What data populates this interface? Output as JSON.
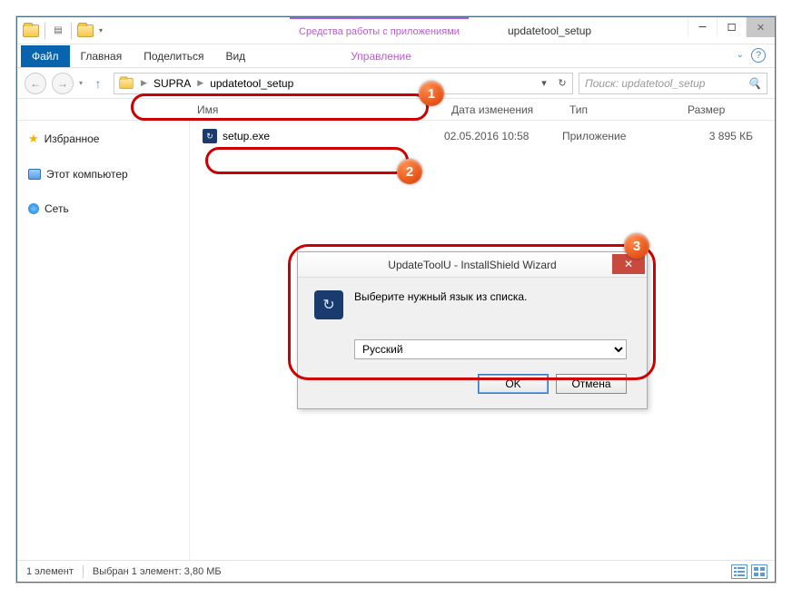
{
  "window": {
    "tools_context": "Средства работы с приложениями",
    "title": "updatetool_setup"
  },
  "ribbon": {
    "file": "Файл",
    "home": "Главная",
    "share": "Поделиться",
    "view": "Вид",
    "manage": "Управление"
  },
  "nav": {
    "crumb1": "SUPRA",
    "crumb2": "updatetool_setup",
    "search_placeholder": "Поиск: updatetool_setup"
  },
  "columns": {
    "name": "Имя",
    "date": "Дата изменения",
    "type": "Тип",
    "size": "Размер"
  },
  "sidebar": {
    "favorites": "Избранное",
    "computer": "Этот компьютер",
    "network": "Сеть"
  },
  "files": [
    {
      "name": "setup.exe",
      "date": "02.05.2016 10:58",
      "type": "Приложение",
      "size": "3 895 КБ"
    }
  ],
  "status": {
    "count": "1 элемент",
    "selection": "Выбран 1 элемент: 3,80 МБ"
  },
  "dialog": {
    "title": "UpdateToolU - InstallShield Wizard",
    "prompt": "Выберите нужный язык из списка.",
    "language": "Русский",
    "ok": "OK",
    "cancel": "Отмена"
  },
  "badges": {
    "one": "1",
    "two": "2",
    "three": "3"
  }
}
